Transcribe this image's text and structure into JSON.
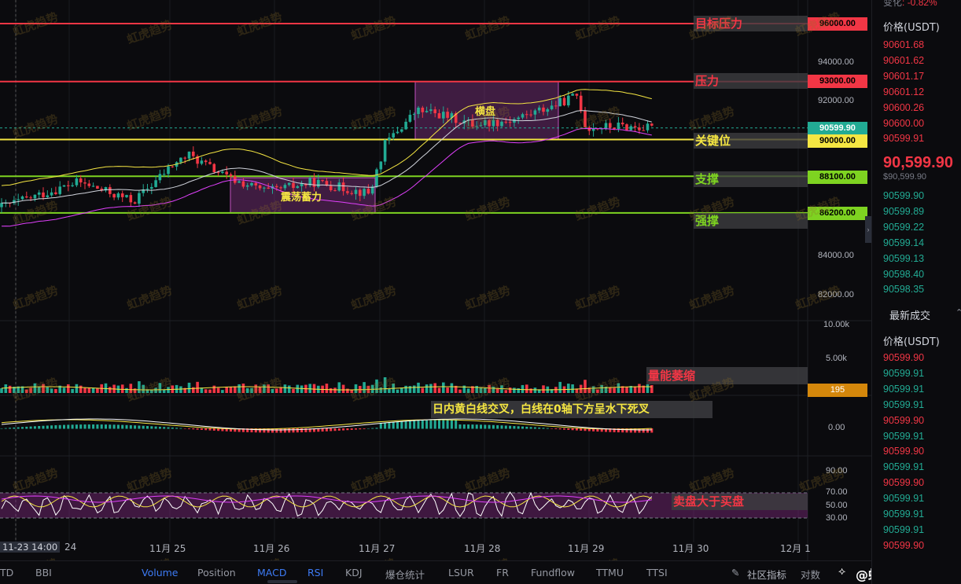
{
  "watermark_text": "虹虎趋势",
  "levels": [
    {
      "key": "target",
      "label": "目标压力",
      "price": 96000,
      "price_label": "96000.00",
      "line_color": "#f23645",
      "label_color": "#f23645",
      "tag_bg": "#f23645",
      "tag_fg": "#000000"
    },
    {
      "key": "resist",
      "label": "压力",
      "price": 93000,
      "price_label": "93000.00",
      "line_color": "#f23645",
      "label_color": "#f23645",
      "tag_bg": "#f23645",
      "tag_fg": "#000000"
    },
    {
      "key": "key",
      "label": "关键位",
      "price": 90000,
      "price_label": "90000.00",
      "line_color": "#f5e642",
      "label_color": "#f5e642",
      "tag_bg": "#f5e642",
      "tag_fg": "#000000"
    },
    {
      "key": "support",
      "label": "支撑",
      "price": 88100,
      "price_label": "88100.00",
      "line_color": "#7ed321",
      "label_color": "#7ed321",
      "tag_bg": "#7ed321",
      "tag_fg": "#000000"
    },
    {
      "key": "strong",
      "label": "强撑",
      "price": 86200,
      "price_label": "86200.00",
      "line_color": "#7ed321",
      "label_color": "#7ed321",
      "tag_bg": "#7ed321",
      "tag_fg": "#000000"
    }
  ],
  "price_axis": {
    "ticks": [
      "94000.00",
      "92000.00",
      "84000.00",
      "82000.00"
    ],
    "current_price": "90599.90",
    "volume_ticks": [
      "10.00k",
      "5.00k"
    ],
    "volume_value": "195",
    "macd_tick": "0.00",
    "rsi_ticks": [
      "90.00",
      "70.00",
      "50.00",
      "30.00"
    ]
  },
  "annotations": {
    "range1": "震荡蓄力",
    "range2": "横盘",
    "volume_note": "量能萎缩",
    "macd_note": "日内黄白线交叉，白线在0轴下方呈水下死叉",
    "rsi_note": "卖盘大于买盘"
  },
  "x_axis": {
    "first": "11-23 14:00",
    "labels": [
      "24",
      "11月 25",
      "11月 26",
      "11月 27",
      "11月 28",
      "11月 29",
      "11月 30",
      "12月 1"
    ]
  },
  "toolbar": {
    "items": [
      {
        "label": "TD",
        "active": false
      },
      {
        "label": "BBI",
        "active": false
      },
      {
        "label": "Volume",
        "active": true
      },
      {
        "label": "Position",
        "active": false
      },
      {
        "label": "MACD",
        "active": true
      },
      {
        "label": "RSI",
        "active": true
      },
      {
        "label": "KDJ",
        "active": false
      },
      {
        "label": "爆仓统计",
        "active": false
      },
      {
        "label": "LSUR",
        "active": false
      },
      {
        "label": "FR",
        "active": false
      },
      {
        "label": "Fundflow",
        "active": false
      },
      {
        "label": "TTMU",
        "active": false
      },
      {
        "label": "TTSI",
        "active": false
      }
    ],
    "community": "社区指标",
    "compare": "对数",
    "brand": "@虹虎趋势"
  },
  "right_panel": {
    "change_label": "变化",
    "change_value": "-0.82%",
    "orderbook_header": "价格(USDT)",
    "asks": [
      "90601.68",
      "90601.62",
      "90601.17",
      "90601.12",
      "90600.26",
      "90600.00",
      "90599.91"
    ],
    "last_price": "90,599.90",
    "last_price_sub": "$90,599.90",
    "bids": [
      "90599.90",
      "90599.89",
      "90599.22",
      "90599.14",
      "90599.13",
      "90598.40",
      "90598.35"
    ],
    "trades_title": "最新成交",
    "trades_header": "价格(USDT)",
    "trades": [
      {
        "price": "90599.90",
        "side": "sell"
      },
      {
        "price": "90599.91",
        "side": "buy"
      },
      {
        "price": "90599.91",
        "side": "buy"
      },
      {
        "price": "90599.91",
        "side": "buy"
      },
      {
        "price": "90599.90",
        "side": "sell"
      },
      {
        "price": "90599.91",
        "side": "buy"
      },
      {
        "price": "90599.90",
        "side": "sell"
      },
      {
        "price": "90599.91",
        "side": "buy"
      },
      {
        "price": "90599.90",
        "side": "sell"
      },
      {
        "price": "90599.91",
        "side": "buy"
      },
      {
        "price": "90599.91",
        "side": "buy"
      },
      {
        "price": "90599.91",
        "side": "buy"
      },
      {
        "price": "90599.90",
        "side": "sell"
      }
    ]
  },
  "colors": {
    "up": "#22ab94",
    "down": "#f23645",
    "boll_upper": "#f5e642",
    "boll_mid": "#d1d4dc",
    "boll_lower": "#e040fb",
    "range_box": "#c050c0"
  }
}
